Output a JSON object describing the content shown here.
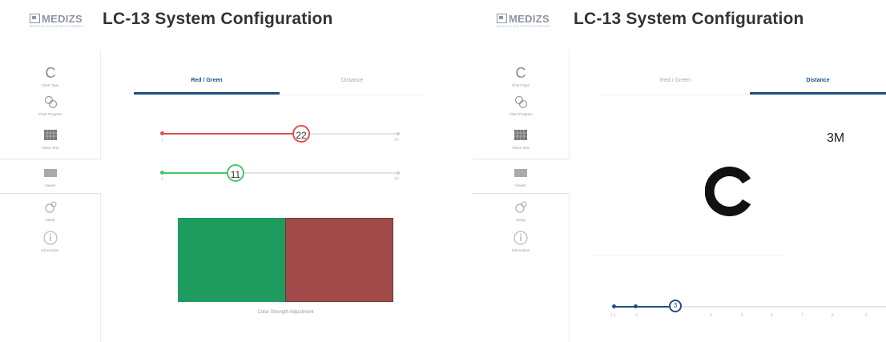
{
  "colors": {
    "accent": "#1f4f82",
    "red": "#df4f56",
    "green": "#4cc46a",
    "swatch_green": "#1e9b5e",
    "swatch_red": "#a04a4a"
  },
  "left": {
    "logo": "MEDIZS",
    "logo_sub": "MEDICAL SOLUTIONS COMPANY",
    "title": "LC-13 System  Configuration",
    "sidebar": [
      {
        "label": "Chart Type",
        "icon": "c-letter-icon"
      },
      {
        "label": "Chart Program",
        "icon": "gears-icon"
      },
      {
        "label": "Vision Test",
        "icon": "grid-icon"
      },
      {
        "label": "Viewer",
        "icon": "screen-icon"
      },
      {
        "label": "Setup",
        "icon": "setup-gear-icon"
      },
      {
        "label": "Information",
        "icon": "info-icon"
      }
    ],
    "tabs": [
      "Red / Green",
      "Distance"
    ],
    "red_slider": {
      "value": "22",
      "min": "1",
      "max": "30"
    },
    "green_slider": {
      "value": "11",
      "min": "1",
      "max": "30"
    },
    "caption": "Color Strength Adjustment"
  },
  "right": {
    "logo": "MEDIZS",
    "logo_sub": "MEDICAL SOLUTIONS COMPANY",
    "title": "LC-13 System  Configuration",
    "sidebar": [
      {
        "label": "Chart Type",
        "icon": "c-letter-icon"
      },
      {
        "label": "Chart Program",
        "icon": "gears-icon"
      },
      {
        "label": "Vision Test",
        "icon": "grid-icon"
      },
      {
        "label": "Viewer",
        "icon": "screen-icon"
      },
      {
        "label": "Setup",
        "icon": "setup-gear-icon"
      },
      {
        "label": "Information",
        "icon": "info-icon"
      }
    ],
    "tabs": [
      "Red / Green",
      "Distance"
    ],
    "distance": "3M",
    "stage_value": "3",
    "stage_ticks": [
      "1.1",
      "2",
      "4",
      "5",
      "6",
      "7",
      "8",
      "9"
    ]
  }
}
